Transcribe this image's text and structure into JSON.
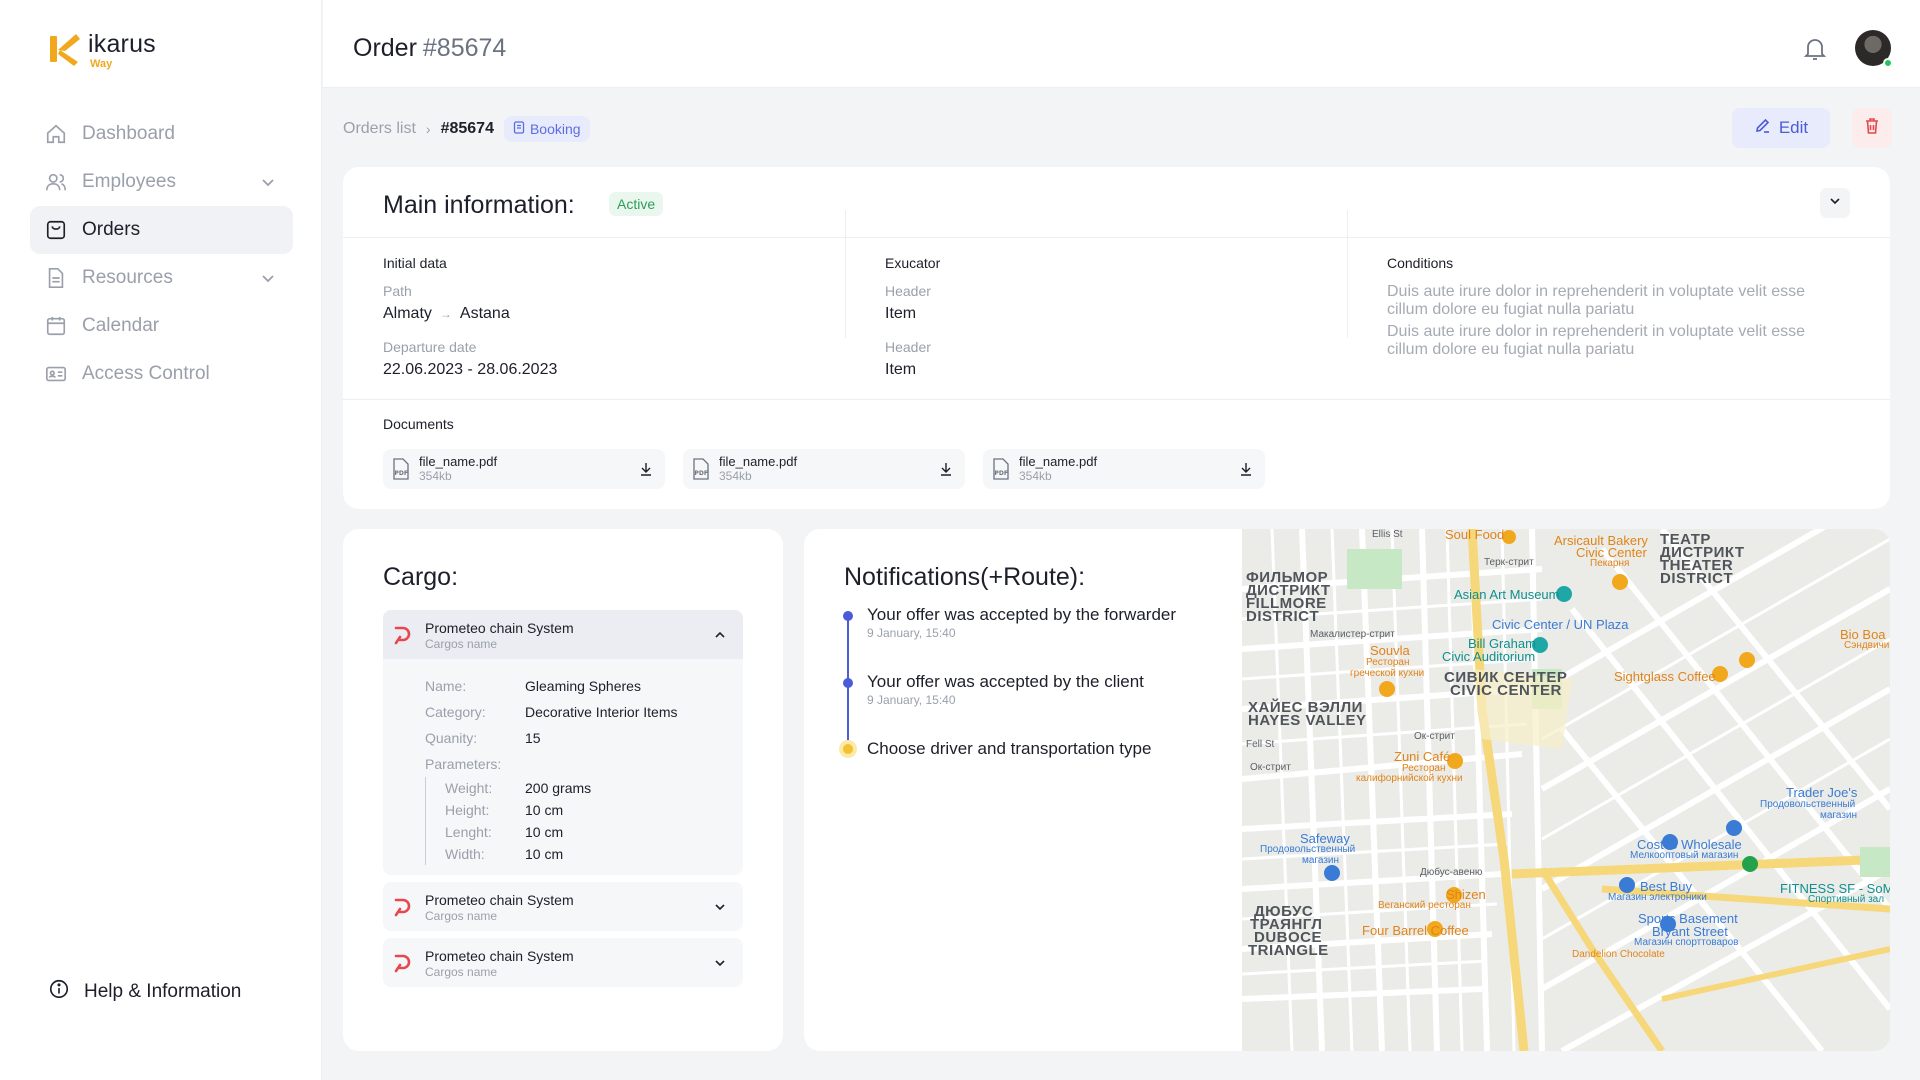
{
  "brand": {
    "name": "ikarus",
    "sub": "Way",
    "accent": "#f2a81d"
  },
  "sidebar": {
    "items": [
      {
        "label": "Dashboard",
        "icon": "home-icon",
        "active": false,
        "expandable": false
      },
      {
        "label": "Employees",
        "icon": "users-icon",
        "active": false,
        "expandable": true
      },
      {
        "label": "Orders",
        "icon": "orders-icon",
        "active": true,
        "expandable": false
      },
      {
        "label": "Resources",
        "icon": "document-icon",
        "active": false,
        "expandable": true
      },
      {
        "label": "Calendar",
        "icon": "calendar-icon",
        "active": false,
        "expandable": false
      },
      {
        "label": "Access Control",
        "icon": "id-card-icon",
        "active": false,
        "expandable": false
      }
    ],
    "help": "Help & Information"
  },
  "header": {
    "title": "Order",
    "order_number": "#85674"
  },
  "breadcrumb": {
    "parent": "Orders list",
    "current": "#85674",
    "badge": "Booking"
  },
  "actions": {
    "edit": "Edit"
  },
  "main_info": {
    "title": "Main information:",
    "status": "Active",
    "initial": {
      "title": "Initial data",
      "path_label": "Path",
      "path_from": "Almaty",
      "path_to": "Astana",
      "date_label": "Departure date",
      "date_value": "22.06.2023 - 28.06.2023"
    },
    "executor": {
      "title": "Exucator",
      "rows": [
        {
          "header": "Header",
          "item": "Item"
        },
        {
          "header": "Header",
          "item": "Item"
        }
      ]
    },
    "conditions": {
      "title": "Conditions",
      "paragraphs": [
        "Duis aute irure dolor in reprehenderit in voluptate velit esse cillum dolore eu fugiat nulla pariatu",
        "Duis aute irure dolor in reprehenderit in voluptate velit esse cillum dolore eu fugiat nulla pariatu"
      ]
    },
    "documents": {
      "title": "Documents",
      "files": [
        {
          "name": "file_name.pdf",
          "size": "354kb"
        },
        {
          "name": "file_name.pdf",
          "size": "354kb"
        },
        {
          "name": "file_name.pdf",
          "size": "354kb"
        }
      ]
    }
  },
  "cargo": {
    "title": "Cargo:",
    "items": [
      {
        "name": "Prometeo chain System",
        "sub": "Cargos name"
      },
      {
        "name": "Prometeo chain System",
        "sub": "Cargos name"
      },
      {
        "name": "Prometeo chain System",
        "sub": "Cargos name"
      }
    ],
    "details": {
      "name_label": "Name:",
      "name": "Gleaming Spheres",
      "category_label": "Category:",
      "category": "Decorative Interior Items",
      "quantity_label": "Quanity:",
      "quantity": "15",
      "parameters_label": "Parameters:",
      "weight_label": "Weight:",
      "weight": "200 grams",
      "height_label": "Height:",
      "height": "10 cm",
      "length_label": "Lenght:",
      "length": "10 cm",
      "width_label": "Width:",
      "width": "10 cm"
    }
  },
  "notifications": {
    "title": "Notifications(+Route):",
    "events": [
      {
        "text": "Your offer was accepted by the forwarder",
        "time": "9 January, 15:40"
      },
      {
        "text": "Your offer was accepted by the client",
        "time": "9 January, 15:40"
      },
      {
        "text": "Choose driver and transportation type",
        "time": ""
      }
    ]
  },
  "map": {
    "labels": {
      "soul_food": "Soul Food",
      "arsicault": "Arsicault Bakery",
      "civic_center": "Civic Center",
      "pekarnya": "Пекарня",
      "theater_1": "ТЕАТР",
      "theater_2": "ДИСТРИКТ",
      "theater_3": "THEATER",
      "theater_4": "DISTRICT",
      "fillmore_1": "ФИЛЬМОР",
      "fillmore_2": "ДИСТРИКТ",
      "fillmore_3": "FILLMORE",
      "fillmore_4": "DISTRICT",
      "asian_art": "Asian Art Museum",
      "civic_un": "Civic Center / UN Plaza",
      "bill_graham_1": "Bill Graham",
      "bill_graham_2": "Civic Auditorium",
      "souvla": "Souvla",
      "souvla_sub1": "Ресторан",
      "souvla_sub2": "греческой кухни",
      "civic_ru": "СИВИК СЕНТЕР",
      "civic_en": "CIVIC CENTER",
      "sightglass": "Sightglass Coffee",
      "bio_boa": "Bio Boa",
      "bio_sub": "Сэндвичи",
      "hayes_ru": "ХАЙЕС ВЭЛЛИ",
      "hayes_en": "HAYES VALLEY",
      "fell": "Fell St",
      "ok_street": "Ок-стрит",
      "zuni": "Zuni Café",
      "zuni_sub1": "Ресторан",
      "zuni_sub2": "калифорнийской кухни",
      "trader_joes": "Trader Joe's",
      "trader_sub1": "Продовольственный",
      "trader_sub2": "магазин",
      "safeway": "Safeway",
      "safeway_sub1": "Продовольственный",
      "safeway_sub2": "магазин",
      "costco": "Costco Wholesale",
      "costco_sub": "Мелкооптовый магазин",
      "dubuce_st": "Дюбус-авеню",
      "best_buy": "Best Buy",
      "best_buy_sub": "Магазин электроники",
      "fitness": "FITNESS SF - SoM",
      "fitness_sub": "Спортивный зал",
      "shizen": "Shizen",
      "shizen_sub": "Веганский ресторан",
      "duboce_1": "ДЮБУС",
      "duboce_2": "ТРАЯНГЛ",
      "duboce_3": "DUBOCE",
      "duboce_4": "TRIANGLE",
      "four_barrel": "Four Barrel Coffee",
      "sports_1": "Sports Basement",
      "sports_2": "Bryant Street",
      "sports_sub": "Магазин спорттоваров",
      "terk": "Терк-стрит",
      "ellis": "Ellis St",
      "mcallister": "Макалистер-стрит",
      "dandelion": "Dandelion Chocolate"
    }
  }
}
